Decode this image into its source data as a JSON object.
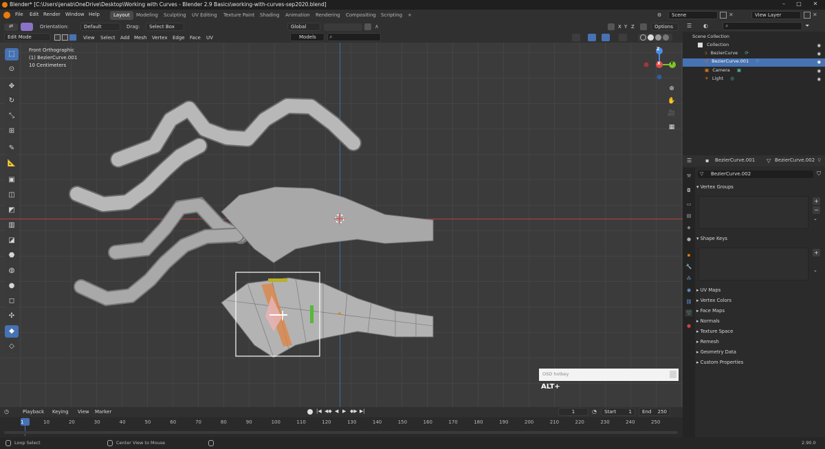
{
  "window": {
    "title": "Blender* [C:\\Users\\jenab\\OneDrive\\Desktop\\Working with Curves - Blender 2.9 Basics\\working-with-curves-sep2020.blend]",
    "btn_min": "–",
    "btn_max": "□",
    "btn_close": "✕"
  },
  "menu": {
    "items": [
      "File",
      "Edit",
      "Render",
      "Window",
      "Help"
    ]
  },
  "workspaces": [
    "Layout",
    "Modeling",
    "Sculpting",
    "UV Editing",
    "Texture Paint",
    "Shading",
    "Animation",
    "Rendering",
    "Compositing",
    "Scripting"
  ],
  "workspace_add": "+",
  "scene": {
    "label": "Scene",
    "view_layer": "View Layer"
  },
  "header3d": {
    "orientation_label": "Orientation:",
    "orientation_value": "Default",
    "drag_label": "Drag:",
    "drag_value": "Select Box",
    "transform": "Global",
    "options": "Options",
    "axes": [
      "X",
      "Y",
      "Z"
    ],
    "mode": "Edit Mode",
    "menus": [
      "View",
      "Select",
      "Add",
      "Mesh",
      "Vertex",
      "Edge",
      "Face",
      "UV"
    ],
    "models": "Models",
    "search_placeholder": ""
  },
  "viewport": {
    "view_name": "Front Orthographic",
    "object": "(1) BezierCurve.001",
    "scale": "10 Centimeters",
    "gizmo": {
      "x": "X",
      "y": "Y",
      "z": "Z"
    }
  },
  "osd": {
    "title": "OSD hotkey",
    "text": "ALT+"
  },
  "timeline": {
    "menus": [
      "Playback",
      "Keying",
      "View",
      "Marker"
    ],
    "current_frame": "1",
    "start_label": "Start",
    "start": "1",
    "end_label": "End",
    "end": "250",
    "ticks": [
      "1",
      "10",
      "20",
      "30",
      "40",
      "50",
      "60",
      "70",
      "80",
      "90",
      "100",
      "110",
      "120",
      "130",
      "140",
      "150",
      "160",
      "170",
      "180",
      "190",
      "200",
      "210",
      "220",
      "230",
      "240",
      "250"
    ],
    "controls": [
      "|◀",
      "◀◆",
      "◀",
      "▶",
      "◆▶",
      "▶|"
    ]
  },
  "status": {
    "left": "Loop Select",
    "middle": "Center View to Mouse",
    "version": "2.90.0"
  },
  "outliner": {
    "rows": [
      {
        "label": "Scene Collection",
        "indent": 0
      },
      {
        "label": "Collection",
        "indent": 1
      },
      {
        "label": "BezierCurve",
        "indent": 2
      },
      {
        "label": "BezierCurve.001",
        "indent": 2,
        "selected": true
      },
      {
        "label": "Camera",
        "indent": 2
      },
      {
        "label": "Light",
        "indent": 2
      }
    ]
  },
  "properties": {
    "object": "BezierCurve.001",
    "data": "BezierCurve.002",
    "datablock": "BezierCurve.002",
    "panels_open": [
      "Vertex Groups",
      "Shape Keys"
    ],
    "panels_closed": [
      "UV Maps",
      "Vertex Colors",
      "Face Maps",
      "Normals",
      "Texture Space",
      "Remesh",
      "Geometry Data",
      "Custom Properties"
    ]
  },
  "colors": {
    "accent": "#4772b3",
    "x_axis": "#e34b4b",
    "y_axis": "#7ec32b",
    "z_axis": "#4a8ee6",
    "orange": "#e87d0d"
  }
}
